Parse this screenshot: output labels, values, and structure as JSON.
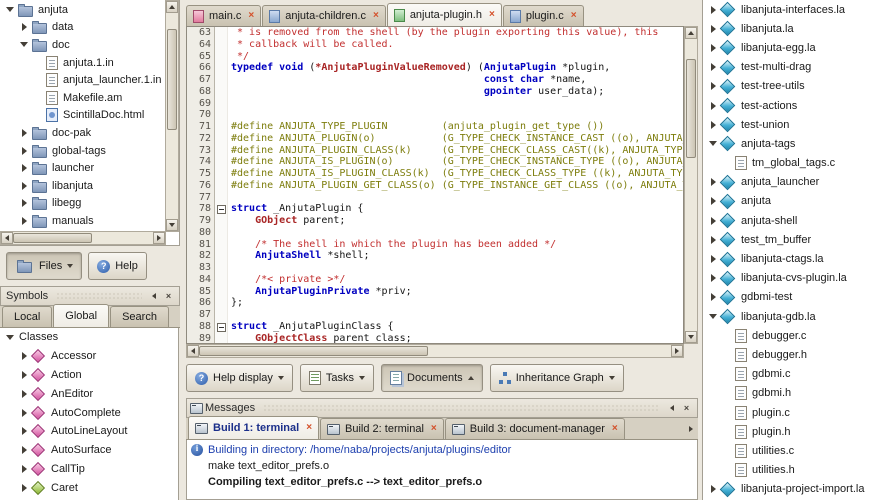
{
  "left_panel": {
    "file_tree": {
      "items": [
        {
          "label": "anjuta",
          "depth": 0,
          "expander": "open",
          "icon": "folder"
        },
        {
          "label": "data",
          "depth": 1,
          "expander": "closed",
          "icon": "folder"
        },
        {
          "label": "doc",
          "depth": 1,
          "expander": "open",
          "icon": "folder"
        },
        {
          "label": "anjuta.1.in",
          "depth": 2,
          "expander": "none",
          "icon": "file"
        },
        {
          "label": "anjuta_launcher.1.in",
          "depth": 2,
          "expander": "none",
          "icon": "file"
        },
        {
          "label": "Makefile.am",
          "depth": 2,
          "expander": "none",
          "icon": "file"
        },
        {
          "label": "ScintillaDoc.html",
          "depth": 2,
          "expander": "none",
          "icon": "html"
        },
        {
          "label": "doc-pak",
          "depth": 1,
          "expander": "closed",
          "icon": "folder"
        },
        {
          "label": "global-tags",
          "depth": 1,
          "expander": "closed",
          "icon": "folder"
        },
        {
          "label": "launcher",
          "depth": 1,
          "expander": "closed",
          "icon": "folder"
        },
        {
          "label": "libanjuta",
          "depth": 1,
          "expander": "closed",
          "icon": "folder"
        },
        {
          "label": "libegg",
          "depth": 1,
          "expander": "closed",
          "icon": "folder"
        },
        {
          "label": "manuals",
          "depth": 1,
          "expander": "closed",
          "icon": "folder"
        }
      ]
    },
    "switch_buttons": [
      {
        "label": "Files",
        "icon": "folder",
        "pressed": true,
        "arrow": "down"
      },
      {
        "label": "Help",
        "icon": "help",
        "pressed": false,
        "arrow": "none"
      }
    ],
    "symbols": {
      "title": "Symbols",
      "tabs": [
        {
          "label": "Local",
          "active": false
        },
        {
          "label": "Global",
          "active": true
        },
        {
          "label": "Search",
          "active": false
        }
      ],
      "items": [
        {
          "label": "Classes",
          "depth": 0,
          "expander": "open",
          "icon": "none"
        },
        {
          "label": "Accessor",
          "depth": 1,
          "expander": "closed",
          "icon": "class"
        },
        {
          "label": "Action",
          "depth": 1,
          "expander": "closed",
          "icon": "class"
        },
        {
          "label": "AnEditor",
          "depth": 1,
          "expander": "closed",
          "icon": "class"
        },
        {
          "label": "AutoComplete",
          "depth": 1,
          "expander": "closed",
          "icon": "class"
        },
        {
          "label": "AutoLineLayout",
          "depth": 1,
          "expander": "closed",
          "icon": "class"
        },
        {
          "label": "AutoSurface",
          "depth": 1,
          "expander": "closed",
          "icon": "class"
        },
        {
          "label": "CallTip",
          "depth": 1,
          "expander": "closed",
          "icon": "class"
        },
        {
          "label": "Caret",
          "depth": 1,
          "expander": "closed",
          "icon": "class-green"
        }
      ]
    }
  },
  "editor": {
    "tabs": [
      {
        "label": "main.c",
        "icon": "tc-red",
        "active": false
      },
      {
        "label": "anjuta-children.c",
        "icon": "tc-blue",
        "active": false
      },
      {
        "label": "anjuta-plugin.h",
        "icon": "tc-green",
        "active": true
      },
      {
        "label": "plugin.c",
        "icon": "tc-blue",
        "active": false
      }
    ],
    "lines": [
      {
        "n": 63,
        "fold": "",
        "segs": [
          [
            "com",
            " * is removed from the shell (by the plugin exporting this value), this"
          ]
        ]
      },
      {
        "n": 64,
        "fold": "",
        "segs": [
          [
            "com",
            " * callback will be called."
          ]
        ]
      },
      {
        "n": 65,
        "fold": "",
        "segs": [
          [
            "com",
            " */"
          ]
        ]
      },
      {
        "n": 66,
        "fold": "",
        "segs": [
          [
            "kw",
            "typedef void"
          ],
          [
            "pl",
            " ("
          ],
          [
            "usr",
            "*AnjutaPluginValueRemoved"
          ],
          [
            "pl",
            ") ("
          ],
          [
            "kw",
            "AnjutaPlugin"
          ],
          [
            "pl",
            " *plugin,"
          ]
        ]
      },
      {
        "n": 67,
        "fold": "",
        "segs": [
          [
            "pl",
            "                                          "
          ],
          [
            "kw",
            "const char"
          ],
          [
            "pl",
            " *name,"
          ]
        ]
      },
      {
        "n": 68,
        "fold": "",
        "segs": [
          [
            "pl",
            "                                          "
          ],
          [
            "kw",
            "gpointer"
          ],
          [
            "pl",
            " user_data);"
          ]
        ]
      },
      {
        "n": 69,
        "fold": "",
        "segs": []
      },
      {
        "n": 70,
        "fold": "",
        "segs": []
      },
      {
        "n": 71,
        "fold": "",
        "segs": [
          [
            "pp",
            "#define ANJUTA_TYPE_PLUGIN         (anjuta_plugin_get_type ())"
          ]
        ]
      },
      {
        "n": 72,
        "fold": "",
        "segs": [
          [
            "pp",
            "#define ANJUTA_PLUGIN(o)           (G_TYPE_CHECK_INSTANCE_CAST ((o), ANJUTA_TY"
          ]
        ]
      },
      {
        "n": 73,
        "fold": "",
        "segs": [
          [
            "pp",
            "#define ANJUTA_PLUGIN_CLASS(k)     (G_TYPE_CHECK_CLASS_CAST((k), ANJUTA_TYPE_P"
          ]
        ]
      },
      {
        "n": 74,
        "fold": "",
        "segs": [
          [
            "pp",
            "#define ANJUTA_IS_PLUGIN(o)        (G_TYPE_CHECK_INSTANCE_TYPE ((o), ANJUTA_TY"
          ]
        ]
      },
      {
        "n": 75,
        "fold": "",
        "segs": [
          [
            "pp",
            "#define ANJUTA_IS_PLUGIN_CLASS(k)  (G_TYPE_CHECK_CLASS_TYPE ((k), ANJUTA_TYPE_"
          ]
        ]
      },
      {
        "n": 76,
        "fold": "",
        "segs": [
          [
            "pp",
            "#define ANJUTA_PLUGIN_GET_CLASS(o) (G_TYPE_INSTANCE_GET_CLASS ((o), ANJUTA_TYP"
          ]
        ]
      },
      {
        "n": 77,
        "fold": "",
        "segs": []
      },
      {
        "n": 78,
        "fold": "-",
        "segs": [
          [
            "kw",
            "struct"
          ],
          [
            "pl",
            " _AnjutaPlugin {"
          ]
        ]
      },
      {
        "n": 79,
        "fold": "",
        "segs": [
          [
            "pl",
            "    "
          ],
          [
            "usr",
            "GObject"
          ],
          [
            "pl",
            " parent;"
          ]
        ]
      },
      {
        "n": 80,
        "fold": "",
        "segs": []
      },
      {
        "n": 81,
        "fold": "",
        "segs": [
          [
            "pl",
            "    "
          ],
          [
            "com",
            "/* The shell in which the plugin has been added */"
          ]
        ]
      },
      {
        "n": 82,
        "fold": "",
        "segs": [
          [
            "pl",
            "    "
          ],
          [
            "kw",
            "AnjutaShell"
          ],
          [
            "pl",
            " *shell;"
          ]
        ]
      },
      {
        "n": 83,
        "fold": "",
        "segs": []
      },
      {
        "n": 84,
        "fold": "",
        "segs": [
          [
            "pl",
            "    "
          ],
          [
            "com",
            "/*< private >*/"
          ]
        ]
      },
      {
        "n": 85,
        "fold": "",
        "segs": [
          [
            "pl",
            "    "
          ],
          [
            "kw",
            "AnjutaPluginPrivate"
          ],
          [
            "pl",
            " *priv;"
          ]
        ]
      },
      {
        "n": 86,
        "fold": "",
        "segs": [
          [
            "pl",
            "};"
          ]
        ]
      },
      {
        "n": 87,
        "fold": "",
        "segs": []
      },
      {
        "n": 88,
        "fold": "-",
        "segs": [
          [
            "kw",
            "struct"
          ],
          [
            "pl",
            " _AnjutaPluginClass {"
          ]
        ]
      },
      {
        "n": 89,
        "fold": "",
        "segs": [
          [
            "pl",
            "    "
          ],
          [
            "usr",
            "GObjectClass"
          ],
          [
            "pl",
            " parent_class;"
          ]
        ]
      }
    ]
  },
  "shortcut_buttons": [
    {
      "label": "Help display",
      "icon": "help",
      "arrow": "down",
      "pressed": false
    },
    {
      "label": "Tasks",
      "icon": "tasks",
      "arrow": "down",
      "pressed": false
    },
    {
      "label": "Documents",
      "icon": "docs",
      "arrow": "up",
      "pressed": true
    },
    {
      "label": "Inheritance Graph",
      "icon": "graph",
      "arrow": "down",
      "pressed": false
    }
  ],
  "messages": {
    "title": "Messages",
    "tabs": [
      {
        "label": "Build 1: terminal",
        "active": true
      },
      {
        "label": "Build 2: terminal",
        "active": false
      },
      {
        "label": "Build 3: document-manager",
        "active": false
      }
    ],
    "lines": [
      {
        "icon": "info",
        "style": "info",
        "text": "Building in directory: /home/naba/projects/anjuta/plugins/editor"
      },
      {
        "icon": "none",
        "style": "plain",
        "text": "make text_editor_prefs.o"
      },
      {
        "icon": "none",
        "style": "bold",
        "text": "Compiling text_editor_prefs.c --> text_editor_prefs.o"
      }
    ]
  },
  "project_tree": {
    "items": [
      {
        "label": "libanjuta-interfaces.la",
        "depth": 0,
        "expander": "closed",
        "icon": "target"
      },
      {
        "label": "libanjuta.la",
        "depth": 0,
        "expander": "closed",
        "icon": "target"
      },
      {
        "label": "libanjuta-egg.la",
        "depth": 0,
        "expander": "closed",
        "icon": "target"
      },
      {
        "label": "test-multi-drag",
        "depth": 0,
        "expander": "closed",
        "icon": "target"
      },
      {
        "label": "test-tree-utils",
        "depth": 0,
        "expander": "closed",
        "icon": "target"
      },
      {
        "label": "test-actions",
        "depth": 0,
        "expander": "closed",
        "icon": "target"
      },
      {
        "label": "test-union",
        "depth": 0,
        "expander": "closed",
        "icon": "target"
      },
      {
        "label": "anjuta-tags",
        "depth": 0,
        "expander": "open",
        "icon": "target"
      },
      {
        "label": "tm_global_tags.c",
        "depth": 1,
        "expander": "none",
        "icon": "file"
      },
      {
        "label": "anjuta_launcher",
        "depth": 0,
        "expander": "closed",
        "icon": "target"
      },
      {
        "label": "anjuta",
        "depth": 0,
        "expander": "closed",
        "icon": "target"
      },
      {
        "label": "anjuta-shell",
        "depth": 0,
        "expander": "closed",
        "icon": "target"
      },
      {
        "label": "test_tm_buffer",
        "depth": 0,
        "expander": "closed",
        "icon": "target"
      },
      {
        "label": "libanjuta-ctags.la",
        "depth": 0,
        "expander": "closed",
        "icon": "target"
      },
      {
        "label": "libanjuta-cvs-plugin.la",
        "depth": 0,
        "expander": "closed",
        "icon": "target"
      },
      {
        "label": "gdbmi-test",
        "depth": 0,
        "expander": "closed",
        "icon": "target"
      },
      {
        "label": "libanjuta-gdb.la",
        "depth": 0,
        "expander": "open",
        "icon": "target"
      },
      {
        "label": "debugger.c",
        "depth": 1,
        "expander": "none",
        "icon": "file"
      },
      {
        "label": "debugger.h",
        "depth": 1,
        "expander": "none",
        "icon": "file"
      },
      {
        "label": "gdbmi.c",
        "depth": 1,
        "expander": "none",
        "icon": "file"
      },
      {
        "label": "gdbmi.h",
        "depth": 1,
        "expander": "none",
        "icon": "file"
      },
      {
        "label": "plugin.c",
        "depth": 1,
        "expander": "none",
        "icon": "file"
      },
      {
        "label": "plugin.h",
        "depth": 1,
        "expander": "none",
        "icon": "file"
      },
      {
        "label": "utilities.c",
        "depth": 1,
        "expander": "none",
        "icon": "file"
      },
      {
        "label": "utilities.h",
        "depth": 1,
        "expander": "none",
        "icon": "file"
      },
      {
        "label": "libanjuta-project-import.la",
        "depth": 0,
        "expander": "closed",
        "icon": "target"
      }
    ]
  }
}
